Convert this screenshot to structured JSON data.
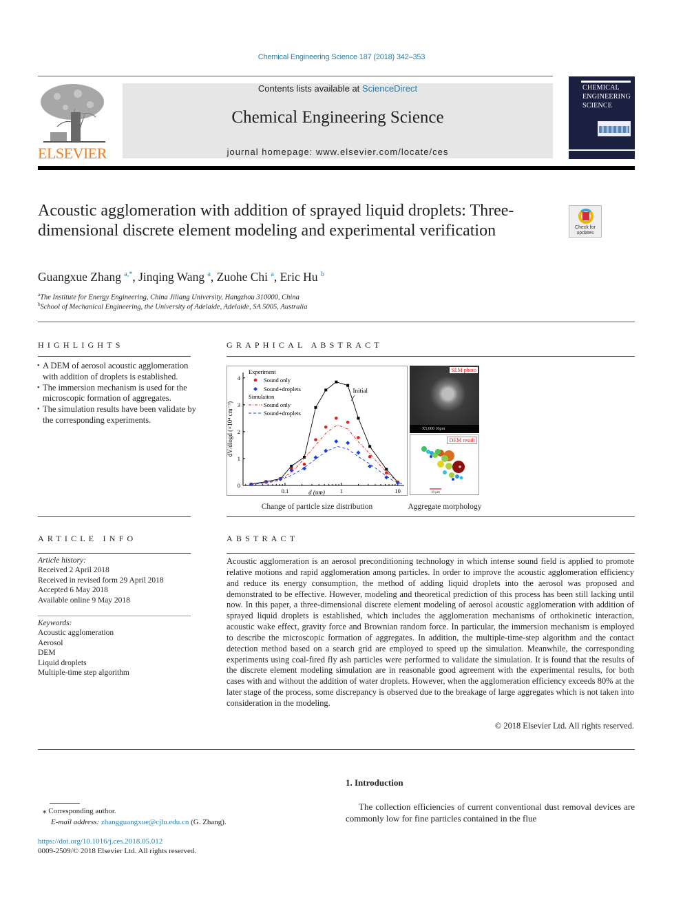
{
  "journal_ref": "Chemical Engineering Science 187 (2018) 342–353",
  "masthead": {
    "contents_prefix": "Contents lists available at ",
    "contents_link": "ScienceDirect",
    "journal_name": "Chemical Engineering Science",
    "homepage": "journal homepage: www.elsevier.com/locate/ces",
    "publisher_logo_text": "ELSEVIER",
    "cover_title": [
      "CHEMICAL",
      "ENGINEERING",
      "SCIENCE"
    ]
  },
  "crossmark": {
    "label": "Check for updates"
  },
  "article": {
    "title": "Acoustic agglomeration with addition of sprayed liquid droplets: Three-dimensional discrete element modeling and experimental verification",
    "authors": [
      {
        "name": "Guangxue Zhang",
        "sup": "a,*"
      },
      {
        "name": "Jinqing Wang",
        "sup": "a"
      },
      {
        "name": "Zuohe Chi",
        "sup": "a"
      },
      {
        "name": "Eric Hu",
        "sup": "b"
      }
    ],
    "affiliations": [
      {
        "key": "a",
        "text": "The Institute for Energy Engineering, China Jiliang University, Hangzhou 310000, China"
      },
      {
        "key": "b",
        "text": "School of Mechanical Engineering, the University of Adelaide, Adelaide, SA 5005, Australia"
      }
    ]
  },
  "highlights": {
    "heading": "HIGHLIGHTS",
    "items": [
      "A DEM of aerosol acoustic agglomeration with addition of droplets is established.",
      "The immersion mechanism is used for the microscopic formation of aggregates.",
      "The simulation results have been validate by the corresponding experiments."
    ]
  },
  "graphical_abstract": {
    "heading": "GRAPHICAL ABSTRACT",
    "chart_caption": "Change of particle size distribution",
    "image_caption": "Aggregate morphology",
    "sem_label": "SEM photo",
    "sem_scale_text": "X5,000   10μm",
    "dem_label": "DEM result",
    "dem_scale_text": "10 μm"
  },
  "chart_data": {
    "type": "line",
    "title": "",
    "xlabel": "d (um)",
    "ylabel": "dV/dlogd (×10⁴ cm⁻³)",
    "xscale": "log",
    "xlim": [
      0.018,
      13
    ],
    "ylim": [
      0,
      4.2
    ],
    "xticks": [
      0.1,
      1,
      10
    ],
    "xtick_labels": [
      "0.1",
      "1",
      "10"
    ],
    "yticks": [
      0,
      1,
      2,
      3,
      4
    ],
    "ytick_labels": [
      "0",
      "1",
      "2",
      "3",
      "4"
    ],
    "grid": false,
    "legend_position": "top-left",
    "legend": {
      "group1": "Experiment",
      "group2": "Simulaiton",
      "entries": [
        "Sound only",
        "Sound+droplets",
        "Sound only",
        "Sound+droplets"
      ]
    },
    "annotation": "Initial",
    "series": [
      {
        "name": "Initial",
        "style": "line-markers",
        "marker": "square",
        "color": "#000000",
        "x": [
          0.025,
          0.046,
          0.083,
          0.13,
          0.22,
          0.35,
          0.53,
          0.81,
          1.3,
          2.0,
          3.2,
          6.3,
          10
        ],
        "y": [
          0.05,
          0.14,
          0.25,
          0.72,
          1.05,
          2.9,
          3.55,
          3.85,
          3.72,
          2.5,
          1.45,
          0.6,
          0.12
        ]
      },
      {
        "name": "Experiment - Sound only",
        "style": "markers",
        "marker": "circle",
        "color": "#e02020",
        "x": [
          0.025,
          0.046,
          0.083,
          0.13,
          0.22,
          0.35,
          0.53,
          0.81,
          1.3,
          2.0,
          3.2,
          6.3,
          10
        ],
        "y": [
          0.04,
          0.13,
          0.24,
          0.62,
          0.79,
          1.7,
          2.17,
          2.5,
          2.35,
          1.78,
          1.07,
          0.47,
          0.12
        ]
      },
      {
        "name": "Experiment - Sound+droplets",
        "style": "markers",
        "marker": "diamond",
        "color": "#1a3de0",
        "x": [
          0.025,
          0.046,
          0.083,
          0.13,
          0.22,
          0.35,
          0.53,
          0.81,
          1.3,
          2.0,
          3.2,
          6.3,
          10
        ],
        "y": [
          0.04,
          0.13,
          0.24,
          0.56,
          0.63,
          1.04,
          1.29,
          1.64,
          1.58,
          1.22,
          0.71,
          0.3,
          0.1
        ]
      },
      {
        "name": "Simulation - Sound only",
        "style": "dash-dot",
        "color": "#e02020",
        "x": [
          0.025,
          0.05,
          0.08,
          0.13,
          0.2,
          0.35,
          0.55,
          0.85,
          1.3,
          2.0,
          3.2,
          5.0,
          8.0,
          12
        ],
        "y": [
          0.05,
          0.12,
          0.22,
          0.48,
          0.9,
          1.5,
          1.98,
          2.25,
          2.1,
          1.62,
          1.18,
          0.72,
          0.3,
          0.05
        ]
      },
      {
        "name": "Simulation - Sound+droplets",
        "style": "dash",
        "color": "#1a3de0",
        "x": [
          0.025,
          0.05,
          0.08,
          0.13,
          0.2,
          0.35,
          0.55,
          0.85,
          1.3,
          2.0,
          3.2,
          5.0,
          8.0,
          12
        ],
        "y": [
          0.04,
          0.1,
          0.19,
          0.38,
          0.6,
          0.98,
          1.28,
          1.45,
          1.35,
          1.07,
          0.8,
          0.5,
          0.2,
          0.05
        ]
      }
    ]
  },
  "article_info": {
    "heading": "ARTICLE INFO",
    "history_label": "Article history:",
    "history": [
      "Received 2 April 2018",
      "Received in revised form 29 April 2018",
      "Accepted 6 May 2018",
      "Available online 9 May 2018"
    ],
    "keywords_label": "Keywords:",
    "keywords": [
      "Acoustic agglomeration",
      "Aerosol",
      "DEM",
      "Liquid droplets",
      "Multiple-time step algorithm"
    ]
  },
  "abstract": {
    "heading": "ABSTRACT",
    "text": "Acoustic agglomeration is an aerosol preconditioning technology in which intense sound field is applied to promote relative motions and rapid agglomeration among particles. In order to improve the acoustic agglomeration efficiency and reduce its energy consumption, the method of adding liquid droplets into the aerosol was proposed and demonstrated to be effective. However, modeling and theoretical prediction of this process has been still lacking until now. In this paper, a three-dimensional discrete element modeling of aerosol acoustic agglomeration with addition of sprayed liquid droplets is established, which includes the agglomeration mechanisms of orthokinetic interaction, acoustic wake effect, gravity force and Brownian random force. In particular, the immersion mechanism is employed to describe the microscopic formation of aggregates. In addition, the multiple-time-step algorithm and the contact detection method based on a search grid are employed to speed up the simulation. Meanwhile, the corresponding experiments using coal-fired fly ash particles were performed to validate the simulation. It is found that the results of the discrete element modeling simulation are in reasonable good agreement with the experimental results, for both cases with and without the addition of water droplets. However, when the agglomeration efficiency exceeds 80% at the later stage of the process, some discrepancy is observed due to the breakage of large aggregates which is not taken into consideration in the modeling.",
    "copyright": "© 2018 Elsevier Ltd. All rights reserved."
  },
  "introduction": {
    "heading": "1. Introduction",
    "text": "The collection efficiencies of current conventional dust removal devices are commonly low for fine particles contained in the flue"
  },
  "footnote": {
    "marker": "⁎",
    "corresponding": "Corresponding author.",
    "email_label": "E-mail address:",
    "email": "zhangguangxue@cjlu.edu.cn",
    "email_suffix": " (G. Zhang).",
    "doi": "https://doi.org/10.1016/j.ces.2018.05.012",
    "issn": "0009-2509/© 2018 Elsevier Ltd. All rights reserved."
  },
  "colors": {
    "link": "#2a7fa8",
    "elsevier_orange": "#f07d1f",
    "cover_navy": "#1c2040",
    "masthead_gray": "#e6e6e6"
  }
}
